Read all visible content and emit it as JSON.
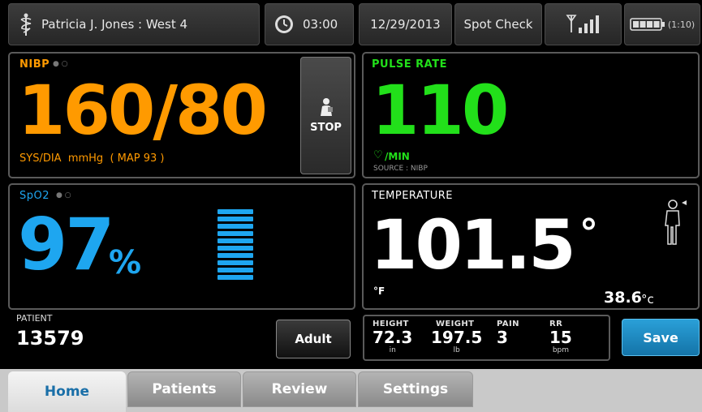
{
  "header": {
    "patient": "Patricia J. Jones : West 4",
    "timer": "03:00",
    "date": "12/29/2013",
    "mode": "Spot Check",
    "battery_time": "(1:10)"
  },
  "nibp": {
    "label": "NIBP",
    "value": "160/80",
    "units": "SYS/DIA  mmHg  ( MAP 93 )",
    "stop_label": "STOP",
    "color": "#ff9a00"
  },
  "pulse": {
    "label": "PULSE RATE",
    "value": "110",
    "units": "/MIN",
    "source": "SOURCE : NIBP",
    "color": "#22e01a"
  },
  "spo2": {
    "label": "SpO2",
    "value": "97",
    "unit": "%",
    "color": "#1ea6f0",
    "pulse_bar_level": 1.0
  },
  "temperature": {
    "label": "TEMPERATURE",
    "value": "101.5",
    "degree": "°",
    "unit_f": "°F",
    "celsius": "38.6",
    "unit_c": "°c"
  },
  "patient": {
    "label": "PATIENT",
    "id": "13579",
    "type_button": "Adult"
  },
  "manual": {
    "height_label": "HEIGHT",
    "height_value": "72.3",
    "height_unit": "in",
    "weight_label": "WEIGHT",
    "weight_value": "197.5",
    "weight_unit": "lb",
    "pain_label": "PAIN",
    "pain_value": "3",
    "rr_label": "RR",
    "rr_value": "15",
    "rr_unit": "bpm"
  },
  "save_label": "Save",
  "tabs": [
    "Home",
    "Patients",
    "Review",
    "Settings"
  ],
  "icons": {
    "caduceus": "caduceus-icon",
    "clock": "clock-icon",
    "signal": "signal-icon",
    "battery": "battery-icon",
    "patient_figure": "patient-figure-icon",
    "stop_figure": "cuff-person-icon",
    "heart": "heart-icon"
  }
}
